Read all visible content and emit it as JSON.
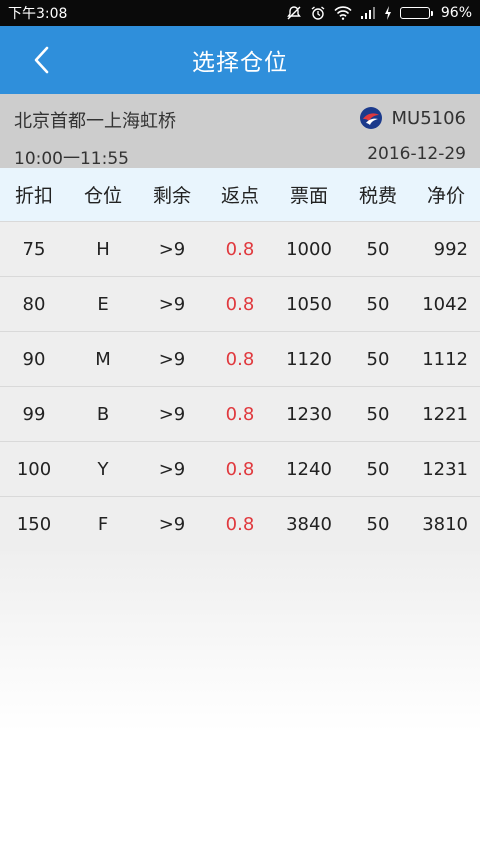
{
  "status_bar": {
    "time": "下午3:08",
    "battery_percent": "96%",
    "battery_level": 0.96
  },
  "header": {
    "title": "选择仓位",
    "accent_color": "#2f8fdb"
  },
  "flight": {
    "route": "北京首都一上海虹桥",
    "flight_no": "MU5106",
    "time_range": "10:00一11:55",
    "date": "2016-12-29"
  },
  "table": {
    "columns": [
      "折扣",
      "仓位",
      "剩余",
      "返点",
      "票面",
      "税费",
      "净价"
    ],
    "rows": [
      {
        "discount": "75",
        "cabin": "H",
        "remaining": ">9",
        "rebate": "0.8",
        "fare": "1000",
        "tax": "50",
        "net": "992"
      },
      {
        "discount": "80",
        "cabin": "E",
        "remaining": ">9",
        "rebate": "0.8",
        "fare": "1050",
        "tax": "50",
        "net": "1042"
      },
      {
        "discount": "90",
        "cabin": "M",
        "remaining": ">9",
        "rebate": "0.8",
        "fare": "1120",
        "tax": "50",
        "net": "1112"
      },
      {
        "discount": "99",
        "cabin": "B",
        "remaining": ">9",
        "rebate": "0.8",
        "fare": "1230",
        "tax": "50",
        "net": "1221"
      },
      {
        "discount": "100",
        "cabin": "Y",
        "remaining": ">9",
        "rebate": "0.8",
        "fare": "1240",
        "tax": "50",
        "net": "1231"
      },
      {
        "discount": "150",
        "cabin": "F",
        "remaining": ">9",
        "rebate": "0.8",
        "fare": "3840",
        "tax": "50",
        "net": "3810"
      }
    ],
    "rebate_color": "#e0393e"
  }
}
